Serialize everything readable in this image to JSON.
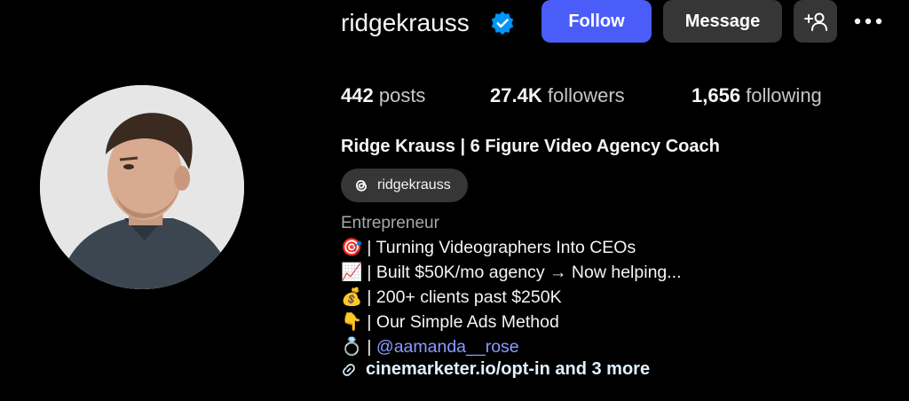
{
  "profile": {
    "username": "ridgekrauss",
    "full_name": "Ridge Krauss | 6 Figure Video Agency Coach",
    "threads_handle": "ridgekrauss",
    "category": "Entrepreneur"
  },
  "actions": {
    "follow_label": "Follow",
    "message_label": "Message"
  },
  "stats": {
    "posts_value": "442",
    "posts_label": "posts",
    "followers_value": "27.4K",
    "followers_label": "followers",
    "following_value": "1,656",
    "following_label": "following"
  },
  "bio": {
    "lines": [
      {
        "emoji": "🎯",
        "text": "| Turning Videographers Into CEOs"
      },
      {
        "emoji": "📈",
        "text": "| Built $50K/mo agency → Now helping..."
      },
      {
        "emoji": "💰",
        "text": "| 200+ clients past $250K"
      },
      {
        "emoji": "👇",
        "text": "| Our Simple Ads Method"
      },
      {
        "emoji": "💍",
        "text": "|"
      }
    ],
    "mention": "@aamanda__rose"
  },
  "link": {
    "text": "cinemarketer.io/opt-in and 3 more"
  },
  "colors": {
    "background": "#000000",
    "follow_button": "#4a5df9",
    "secondary_button": "#363636",
    "mention": "#8c9bff",
    "verified_badge": "#0095f6"
  },
  "icons": {
    "verified": "verified-badge-icon",
    "add_user": "add-user-icon",
    "more": "more-options-icon",
    "threads": "threads-icon",
    "link": "link-icon"
  }
}
